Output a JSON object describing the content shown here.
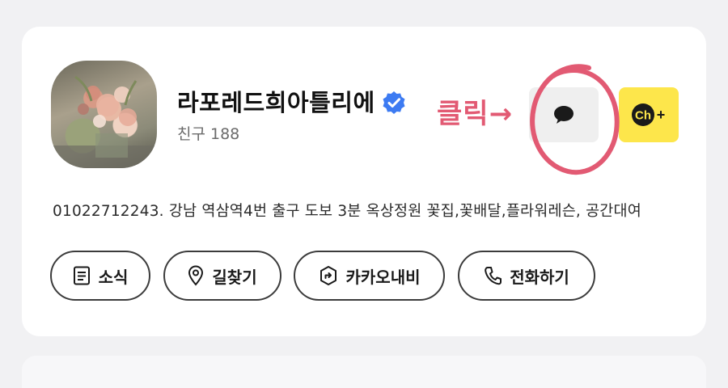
{
  "profile": {
    "name": "라포레드희아틀리에",
    "friends_label": "친구 188",
    "description": "01022712243. 강남 역삼역4번 출구 도보 3분 옥상정원 꽃집,꽃배달,플라워레슨, 공간대여"
  },
  "annotation": {
    "text": "클릭",
    "arrow": "→"
  },
  "header_buttons": {
    "chat_icon": "speech-bubble-icon",
    "add_channel_text": "Ch",
    "add_channel_plus": "+"
  },
  "actions": [
    {
      "label": "소식",
      "icon": "news-icon"
    },
    {
      "label": "길찾기",
      "icon": "location-pin-icon"
    },
    {
      "label": "카카오내비",
      "icon": "navigation-icon"
    },
    {
      "label": "전화하기",
      "icon": "phone-icon"
    }
  ],
  "colors": {
    "accent_yellow": "#fde64b",
    "annotation_pink": "#e25a73",
    "verified_blue": "#3d7bf2"
  }
}
